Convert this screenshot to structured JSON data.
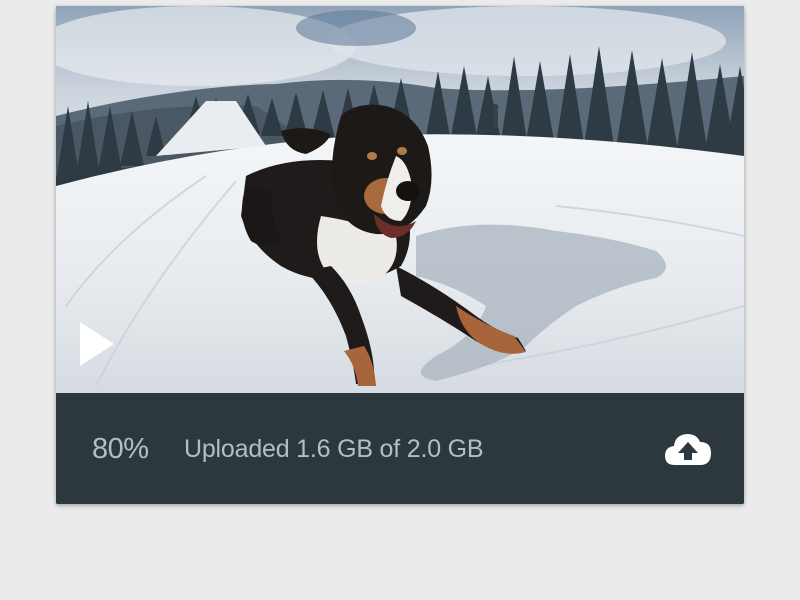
{
  "upload": {
    "percent_label": "80%",
    "progress": 0.8,
    "status_text": "Uploaded 1.6 GB of 2.0 GB"
  },
  "icons": {
    "play": "play-icon",
    "upload": "cloud-upload-icon"
  },
  "colors": {
    "footer_background": "#2d373e",
    "footer_text": "#b4bdc4",
    "page_background": "#ebebeb",
    "icon": "#ffffff"
  }
}
